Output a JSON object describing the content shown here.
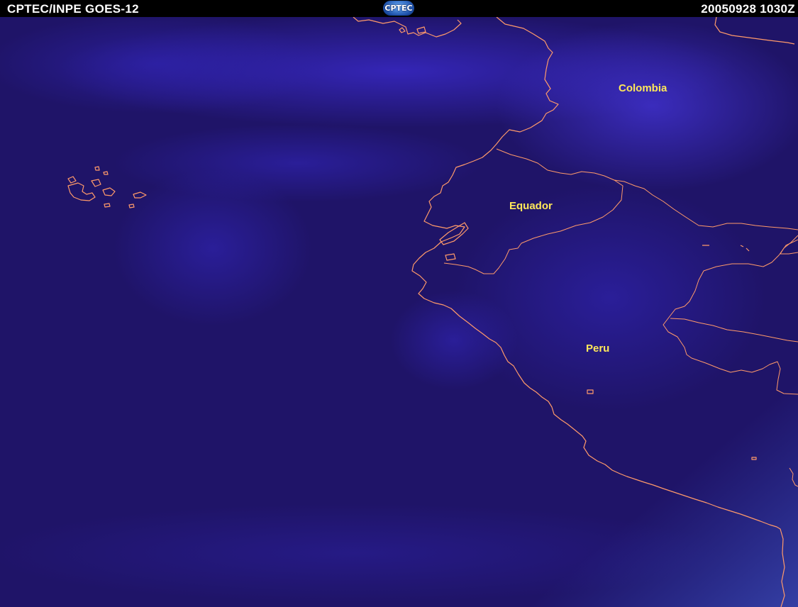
{
  "header": {
    "left_title": "CPTEC/INPE GOES-12",
    "logo_text": "CPTEC",
    "timestamp": "20050928  1030Z"
  },
  "map": {
    "labels": [
      {
        "name": "Colombia"
      },
      {
        "name": "Equador"
      },
      {
        "name": "Peru"
      }
    ],
    "colors": {
      "background": "#1f1468",
      "cloud": "#3828c8",
      "coastline": "#ff9a6a",
      "label": "#ffe85a"
    }
  }
}
